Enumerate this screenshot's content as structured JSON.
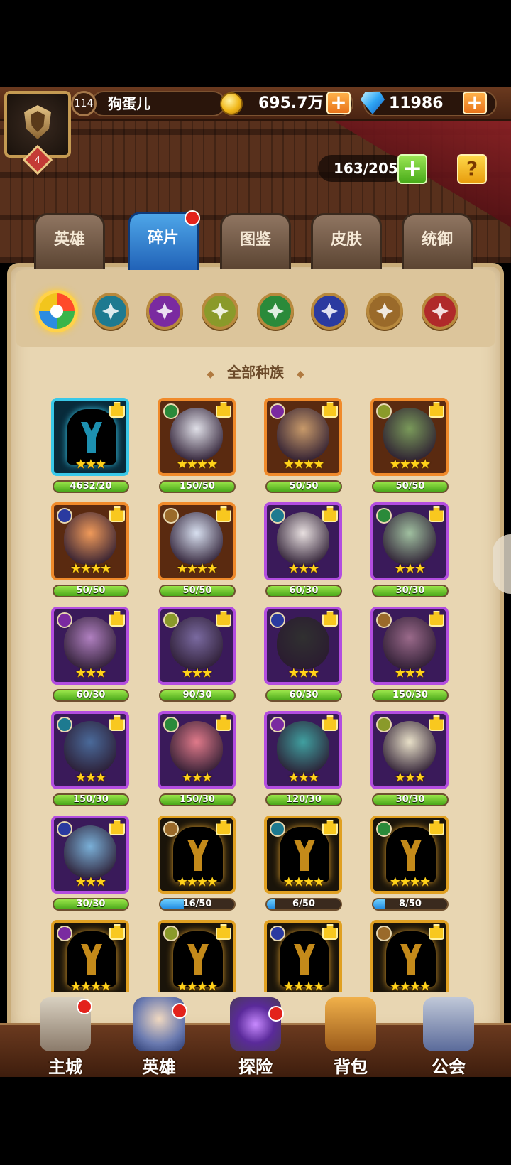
{
  "header": {
    "player_level": "114",
    "player_name": "狗蛋儿",
    "vip_level": "4",
    "gold": "695.7万",
    "gems": "11986",
    "plus_symbol": "+"
  },
  "inventory": {
    "capacity": "163/205",
    "add_symbol": "+",
    "help_symbol": "?"
  },
  "tabs": [
    {
      "label": "英雄"
    },
    {
      "label": "碎片",
      "active": true
    },
    {
      "label": "图鉴"
    },
    {
      "label": "皮肤"
    },
    {
      "label": "统御"
    }
  ],
  "race_filters": [
    "all-races",
    "shadow",
    "fortress",
    "abyss",
    "forest",
    "dark",
    "transcendence",
    "inferno"
  ],
  "section_title": "全部种族",
  "section_deco": "◆",
  "heroes": [
    {
      "stars": "★★★",
      "count": "4632/20",
      "progress": 1.0,
      "frame": "teal",
      "locked": true
    },
    {
      "stars": "★★★★",
      "count": "150/50",
      "progress": 1.0,
      "frame": "orange"
    },
    {
      "stars": "★★★★",
      "count": "50/50",
      "progress": 1.0,
      "frame": "orange"
    },
    {
      "stars": "★★★★",
      "count": "50/50",
      "progress": 1.0,
      "frame": "orange"
    },
    {
      "stars": "★★★★",
      "count": "50/50",
      "progress": 1.0,
      "frame": "orange"
    },
    {
      "stars": "★★★★",
      "count": "50/50",
      "progress": 1.0,
      "frame": "orange"
    },
    {
      "stars": "★★★",
      "count": "60/30",
      "progress": 1.0,
      "frame": "purple"
    },
    {
      "stars": "★★★",
      "count": "30/30",
      "progress": 1.0,
      "frame": "purple"
    },
    {
      "stars": "★★★",
      "count": "60/30",
      "progress": 1.0,
      "frame": "purple"
    },
    {
      "stars": "★★★",
      "count": "90/30",
      "progress": 1.0,
      "frame": "purple"
    },
    {
      "stars": "★★★",
      "count": "60/30",
      "progress": 1.0,
      "frame": "purple"
    },
    {
      "stars": "★★★",
      "count": "150/30",
      "progress": 1.0,
      "frame": "purple"
    },
    {
      "stars": "★★★",
      "count": "150/30",
      "progress": 1.0,
      "frame": "purple"
    },
    {
      "stars": "★★★",
      "count": "150/30",
      "progress": 1.0,
      "frame": "purple"
    },
    {
      "stars": "★★★",
      "count": "120/30",
      "progress": 1.0,
      "frame": "purple"
    },
    {
      "stars": "★★★",
      "count": "30/30",
      "progress": 1.0,
      "frame": "purple"
    },
    {
      "stars": "★★★",
      "count": "30/30",
      "progress": 1.0,
      "frame": "purple"
    },
    {
      "stars": "★★★★",
      "count": "16/50",
      "progress": 0.32,
      "frame": "locked",
      "locked": true
    },
    {
      "stars": "★★★★",
      "count": "6/50",
      "progress": 0.12,
      "frame": "locked",
      "locked": true
    },
    {
      "stars": "★★★★",
      "count": "8/50",
      "progress": 0.16,
      "frame": "locked",
      "locked": true
    },
    {
      "stars": "★★★★",
      "count": "",
      "progress": 0,
      "frame": "locked",
      "locked": true
    },
    {
      "stars": "★★★★",
      "count": "",
      "progress": 0,
      "frame": "locked",
      "locked": true
    },
    {
      "stars": "★★★★",
      "count": "",
      "progress": 0,
      "frame": "locked",
      "locked": true
    },
    {
      "stars": "★★★★",
      "count": "",
      "progress": 0,
      "frame": "locked",
      "locked": true
    }
  ],
  "nav": [
    {
      "label": "主城",
      "badge": true
    },
    {
      "label": "英雄",
      "badge": true
    },
    {
      "label": "探险",
      "badge": true
    },
    {
      "label": "背包",
      "badge": false
    },
    {
      "label": "公会",
      "badge": false
    }
  ],
  "colors": {
    "accent": "#f08a2a",
    "active_tab": "#1f5fb5",
    "progress_full": "#4aa81a",
    "progress_partial": "#1f8ae0",
    "badge": "#e3221b"
  }
}
